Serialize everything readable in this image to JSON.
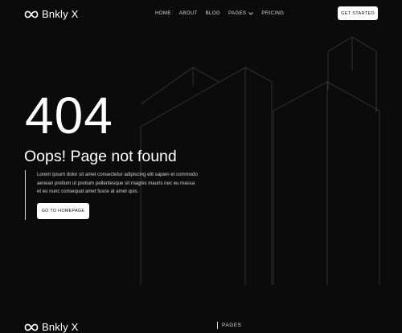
{
  "brand": {
    "name": "Bnkly X",
    "icon": "infinity-logo-icon"
  },
  "nav": {
    "items": [
      "HOME",
      "ABOUT",
      "BLOG"
    ],
    "pages_label": "PAGES",
    "pricing_label": "PRICING"
  },
  "header": {
    "cta_label": "GET STARTED"
  },
  "error": {
    "code": "404",
    "title": "Oops! Page not found",
    "description": "Lorem ipsum dolor sit amet consectetur adipiscing elit sapien et commodo aenean pretium ut pretium pellentesque sit magnis mauris nec eu massa et eu nunc consequat amet fusce at amet quis.",
    "button_label": "GO TO HOMEPAGE"
  },
  "footer": {
    "brand": "Bnkly X",
    "heading": "PAGES"
  },
  "colors": {
    "background": "#0b0b0b",
    "text": "#ffffff",
    "button": "#ffffff"
  }
}
